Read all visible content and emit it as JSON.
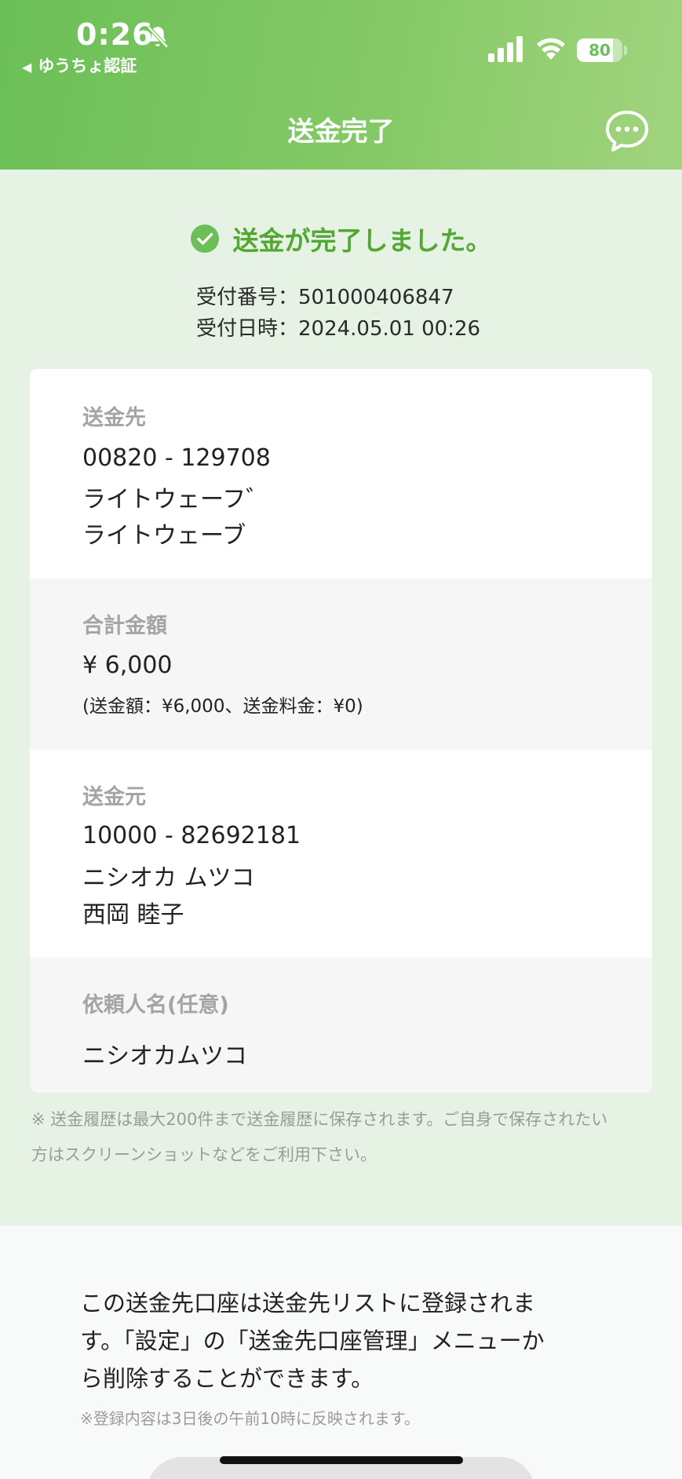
{
  "status_bar": {
    "time": "0:26",
    "back_app": "ゆうちょ認証",
    "battery_level": "80",
    "battery_fraction": 0.8
  },
  "header": {
    "title": "送金完了",
    "chat_icon": "chat-bubble-icon"
  },
  "success": {
    "message": "送金が完了しました。",
    "receipt_number": "受付番号：501000406847",
    "receipt_datetime": "受付日時：2024.05.01 00:26"
  },
  "recipient": {
    "label": "送金先",
    "account": "00820 - 129708",
    "name_kana_1": "ライトウェーフ゛",
    "name_kana_2": "ライトウェーブ"
  },
  "total": {
    "label": "合計金額",
    "amount": "¥ 6,000",
    "breakdown": "(送金額：¥6,000、送金料金：¥0)"
  },
  "sender": {
    "label": "送金元",
    "account": "10000 - 82692181",
    "name_kana": "ニシオカ ムツコ",
    "name_kanji": "西岡 睦子"
  },
  "requester": {
    "label": "依頼人名(任意)",
    "value": "ニシオカムツコ"
  },
  "history_note_line1": "※ 送金履歴は最大200件まで送金履歴に保存されます。ご自身で保存されたい",
  "history_note_line2": "方はスクリーンショットなどをご利用下さい。",
  "registration": {
    "line1": "この送金先口座は送金先リストに登録されま",
    "line2": "す。「設定」の「送金先口座管理」メニューか",
    "line3": "ら削除することができます。",
    "sub_note": "※登録内容は3日後の午前10時に反映されます。"
  },
  "colors": {
    "header_green": "#6cbf58",
    "success_green": "#52a832",
    "page_bg": "#e6f3e4"
  }
}
